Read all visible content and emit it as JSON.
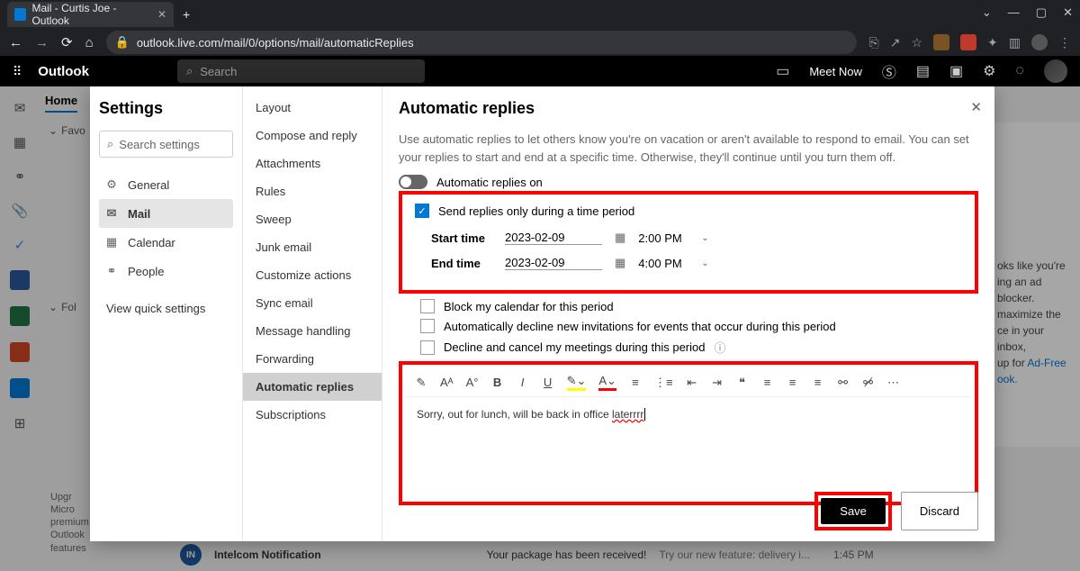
{
  "browser": {
    "tab_title": "Mail - Curtis Joe - Outlook",
    "url": "outlook.live.com/mail/0/options/mail/automaticReplies"
  },
  "outlook_header": {
    "brand": "Outlook",
    "search_placeholder": "Search",
    "meet_now": "Meet Now"
  },
  "home_tab": "Home",
  "folders": {
    "fav": "Favo",
    "fol": "Fol"
  },
  "right_panel": {
    "line1": "oks like you're",
    "line2": "ing an ad blocker.",
    "line3": "maximize the",
    "line4": "ce in your inbox,",
    "line5": "up for ",
    "link": "Ad-Free ook."
  },
  "mail_row": {
    "sender": "Intelcom Notification",
    "subject": "Your package has been received!",
    "preview": "Try our new feature: delivery i...",
    "time": "1:45 PM",
    "initials": "IN"
  },
  "upgrade": "Upgr Micro premium Outlook features",
  "settings": {
    "title": "Settings",
    "search_placeholder": "Search settings",
    "nav": {
      "general": "General",
      "mail": "Mail",
      "calendar": "Calendar",
      "people": "People",
      "quick": "View quick settings"
    },
    "mid": {
      "layout": "Layout",
      "compose": "Compose and reply",
      "attachments": "Attachments",
      "rules": "Rules",
      "sweep": "Sweep",
      "junk": "Junk email",
      "customize": "Customize actions",
      "sync": "Sync email",
      "handling": "Message handling",
      "forwarding": "Forwarding",
      "auto": "Automatic replies",
      "subs": "Subscriptions"
    },
    "main": {
      "title": "Automatic replies",
      "description": "Use automatic replies to let others know you're on vacation or aren't available to respond to email. You can set your replies to start and end at a specific time. Otherwise, they'll continue until you turn them off.",
      "toggle_label": "Automatic replies on",
      "checkbox_period": "Send replies only during a time period",
      "start_label": "Start time",
      "start_date": "2023-02-09",
      "start_time": "2:00 PM",
      "end_label": "End time",
      "end_date": "2023-02-09",
      "end_time": "4:00 PM",
      "opt_block": "Block my calendar for this period",
      "opt_decline_new": "Automatically decline new invitations for events that occur during this period",
      "opt_decline_cancel": "Decline and cancel my meetings during this period",
      "editor_text": "Sorry, out for lunch, will be back in office ",
      "editor_misspell": "laterrrr",
      "save": "Save",
      "discard": "Discard"
    }
  }
}
